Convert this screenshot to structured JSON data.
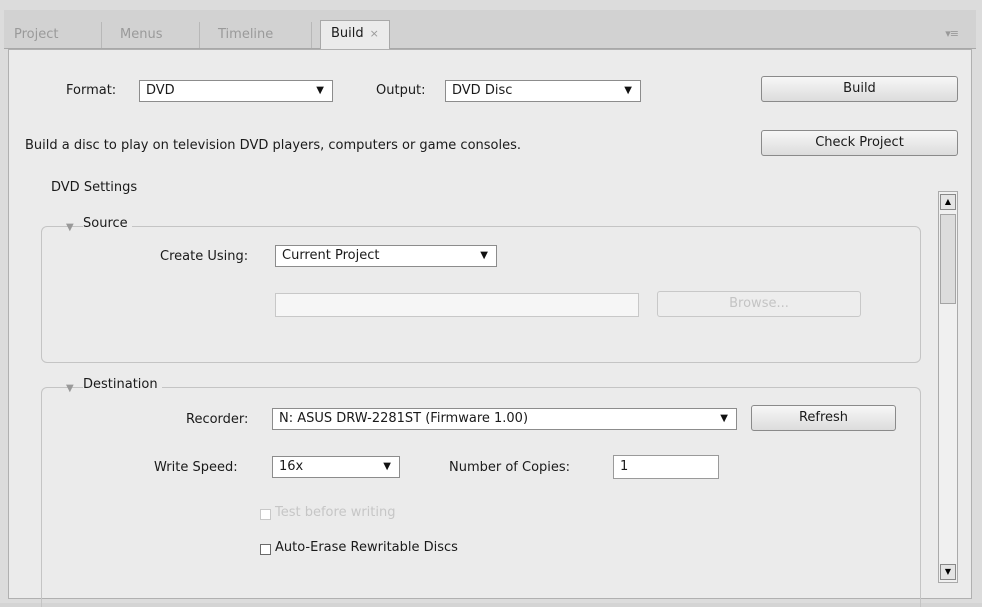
{
  "tabs": [
    {
      "label": "Project"
    },
    {
      "label": "Menus"
    },
    {
      "label": "Timeline"
    },
    {
      "label": "Build",
      "close": "×"
    }
  ],
  "panel_menu_icon": "▾≡",
  "format": {
    "label": "Format:",
    "value": "DVD"
  },
  "output": {
    "label": "Output:",
    "value": "DVD Disc"
  },
  "build_button": "Build",
  "check_project_button": "Check Project",
  "description": "Build a disc to play on television DVD players, computers or game consoles.",
  "settings_heading": "DVD Settings",
  "source": {
    "heading": "Source",
    "create_using_label": "Create Using:",
    "create_using_value": "Current Project",
    "path_value": "",
    "browse_button": "Browse..."
  },
  "destination": {
    "heading": "Destination",
    "recorder_label": "Recorder:",
    "recorder_value": "N: ASUS DRW-2281ST (Firmware 1.00)",
    "refresh_button": "Refresh",
    "write_speed_label": "Write Speed:",
    "write_speed_value": "16x",
    "copies_label": "Number of Copies:",
    "copies_value": "1",
    "test_checkbox_label": "Test before writing",
    "auto_erase_label": "Auto-Erase Rewritable Discs"
  },
  "icons": {
    "dropdown": "chevron-down-icon",
    "expand": "triangle-down-icon",
    "scroll_up": "scroll-up-icon",
    "scroll_down": "scroll-down-icon"
  }
}
